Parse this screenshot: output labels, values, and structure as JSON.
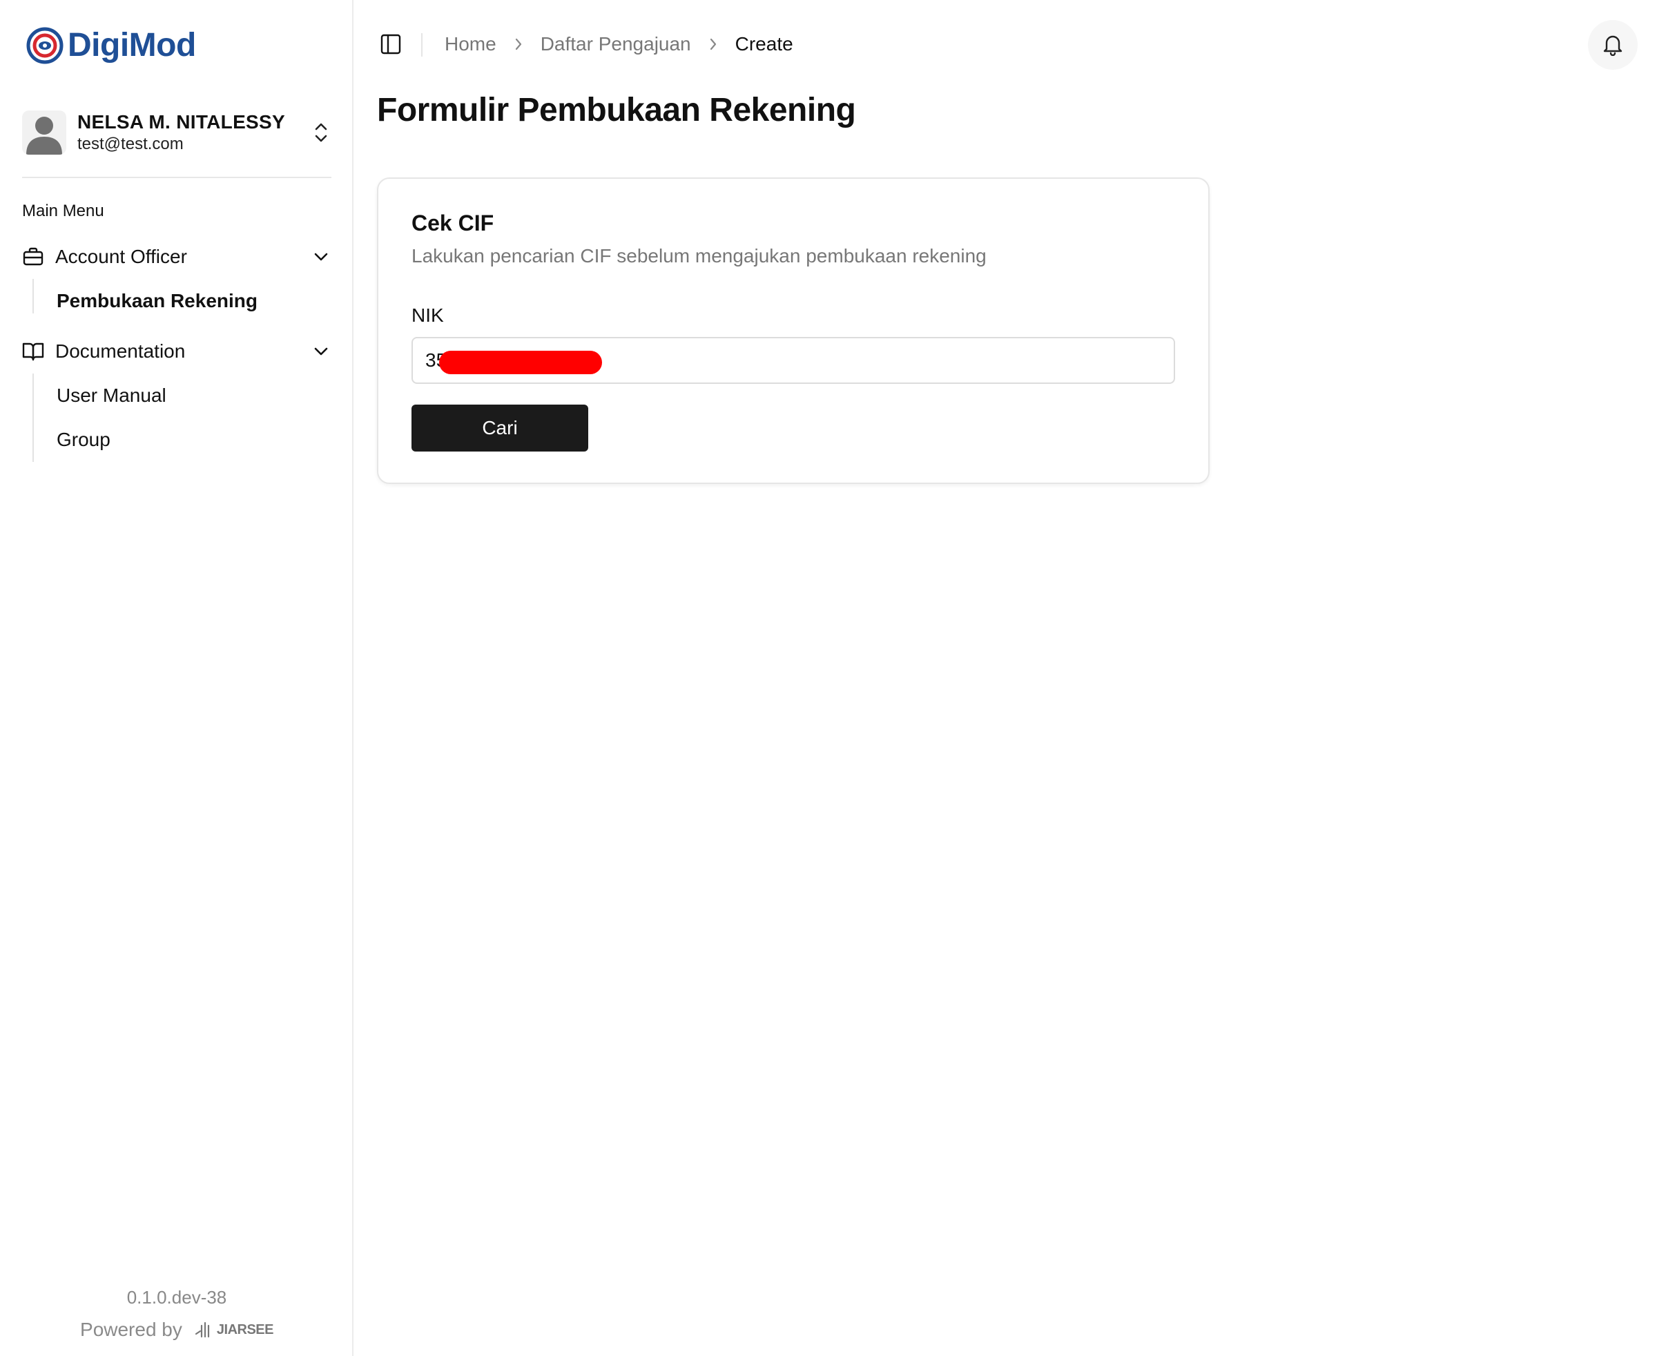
{
  "app": {
    "logo_text": "DigiMod"
  },
  "user": {
    "name": "NELSA M. NITALESSY",
    "email": "test@test.com"
  },
  "sidebar": {
    "menu_title": "Main Menu",
    "groups": [
      {
        "label": "Account Officer",
        "icon": "briefcase-icon",
        "items": [
          {
            "label": "Pembukaan Rekening",
            "active": true
          }
        ]
      },
      {
        "label": "Documentation",
        "icon": "book-open-icon",
        "items": [
          {
            "label": "User Manual"
          },
          {
            "label": "Group"
          }
        ]
      }
    ],
    "version": "0.1.0.dev-38",
    "powered_by": "Powered by",
    "powered_brand": "JIARSEE"
  },
  "breadcrumb": [
    "Home",
    "Daftar Pengajuan",
    "Create"
  ],
  "page": {
    "title": "Formulir Pembukaan Rekening"
  },
  "card": {
    "title": "Cek CIF",
    "description": "Lakukan pencarian CIF sebelum mengajukan pembukaan rekening",
    "nik_label": "NIK",
    "nik_value": "35",
    "button_label": "Cari"
  },
  "colors": {
    "brand_blue": "#1f4f96",
    "brand_red": "#d7282f",
    "button_dark": "#1b1b1b",
    "redaction": "#ff0000"
  }
}
